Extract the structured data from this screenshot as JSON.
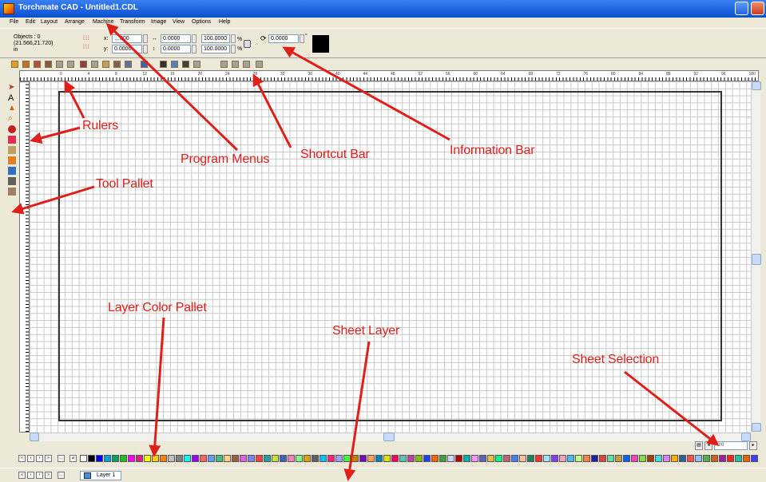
{
  "window": {
    "title": "Torchmate CAD - Untitled1.CDL"
  },
  "menus": [
    "File",
    "Edit",
    "Layout",
    "Arrange",
    "Machine",
    "Transform",
    "Image",
    "View",
    "Options",
    "Help"
  ],
  "info_bar": {
    "objects": "Objects : 0",
    "coords": "(21.566,21.720)",
    "unit": "in",
    "x_label": "x:",
    "x_value": "…000",
    "y_label": "y:",
    "y_value": "0.0000",
    "width_value": "0.0000",
    "height_value": "0.0000",
    "scale_x": "100.0000",
    "scale_y": "100.0000",
    "scale_unit": "%",
    "rotation_value": "0.0000",
    "rotation_unit": "°",
    "color_swatch": "#000000"
  },
  "ruler_top_numbers": [
    "0",
    "4",
    "8",
    "12",
    "16",
    "20",
    "24",
    "28",
    "32",
    "36",
    "40",
    "44",
    "48",
    "52",
    "56",
    "60",
    "64",
    "68",
    "72",
    "76",
    "80",
    "84",
    "88",
    "92",
    "96",
    "100"
  ],
  "sheet_selection": {
    "value": "0/0"
  },
  "layer_bar": {
    "layer_tab": "Layer 1"
  },
  "palette_colors": [
    "#ffffff",
    "#000000",
    "#0000ff",
    "#00a0e0",
    "#00a060",
    "#20c020",
    "#ff00ff",
    "#e01a80",
    "#ffff00",
    "#ffd000",
    "#ff8000",
    "#c0c0c0",
    "#808080",
    "#00ffff",
    "#a000ff",
    "#ff6060",
    "#60a0ff",
    "#40c080",
    "#ffd080",
    "#a06040",
    "#e060e0",
    "#8080ff",
    "#ff4040",
    "#20a0a0",
    "#c0e040",
    "#4060c0",
    "#ff80c0",
    "#80ff80",
    "#e0a000",
    "#606060",
    "#00c0ff",
    "#ff2080",
    "#a0a0ff",
    "#40ff40",
    "#c08000",
    "#8000c0",
    "#ffa060",
    "#0080c0",
    "#e0e000",
    "#ff0060",
    "#60c0c0",
    "#c040a0",
    "#80c000",
    "#2040ff",
    "#ff6000",
    "#40a040",
    "#d0d0ff",
    "#b00000",
    "#00b0b0",
    "#ff90ff",
    "#6060c0",
    "#e0c040",
    "#00ff80",
    "#c06080",
    "#4080ff",
    "#ffc0a0",
    "#208060",
    "#ff3030",
    "#a0e0ff",
    "#8040ff",
    "#f0a0c0",
    "#40c0ff",
    "#c0ff80",
    "#ff8040",
    "#2020a0",
    "#e04040",
    "#60e0a0",
    "#c0a040",
    "#0060ff",
    "#ff40c0",
    "#80e040",
    "#a04000",
    "#40e0e0",
    "#e080ff",
    "#ffb000",
    "#3060a0",
    "#ff5050",
    "#90c0ff",
    "#50b050",
    "#d06020",
    "#a020a0",
    "#ff2020",
    "#20c0a0",
    "#f06000",
    "#4040ff"
  ],
  "callouts": {
    "rulers": "Rulers",
    "program_menus": "Program Menus",
    "shortcut_bar": "Shortcut Bar",
    "information_bar": "Information Bar",
    "tool_pallet": "Tool Pallet",
    "layer_color_pallet": "Layer Color Pallet",
    "sheet_layer": "Sheet Layer",
    "sheet_selection": "Sheet Selection"
  },
  "annotation_color": "#e01f1a"
}
